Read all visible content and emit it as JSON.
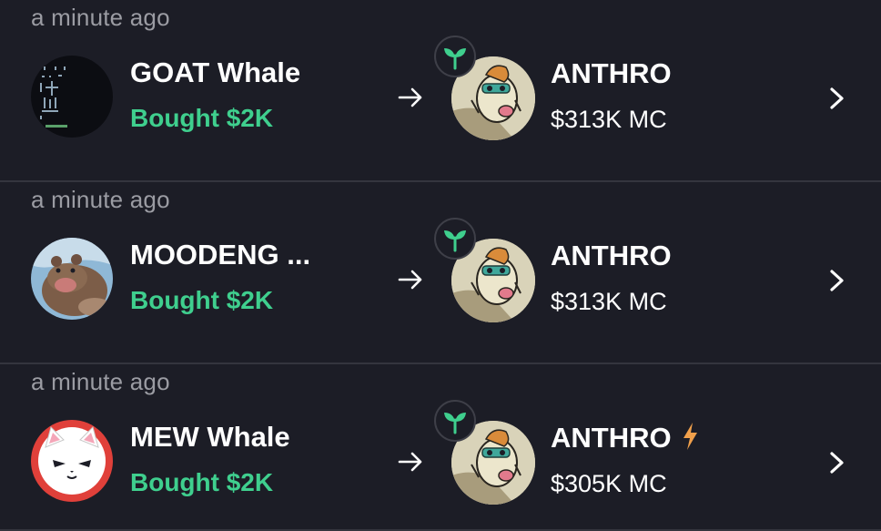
{
  "feed": {
    "entries": [
      {
        "time": "a minute ago",
        "whale_name": "GOAT Whale",
        "action": "Bought $2K",
        "avatar_icon": "goat-ascii-avatar",
        "token": {
          "name": "ANTHRO",
          "market_cap": "$313K MC",
          "badge_icon": "sprout-icon"
        }
      },
      {
        "time": "a minute ago",
        "whale_name": "MOODENG ...",
        "action": "Bought $2K",
        "avatar_icon": "hippo-avatar",
        "token": {
          "name": "ANTHRO",
          "market_cap": "$313K MC",
          "badge_icon": "sprout-icon"
        }
      },
      {
        "time": "a minute ago",
        "whale_name": "MEW Whale",
        "action": "Bought $2K",
        "avatar_icon": "cat-avatar",
        "token": {
          "name": "ANTHRO",
          "market_cap": "$305K MC",
          "badge_icon": "sprout-icon",
          "trend_icon": "lightning-icon"
        }
      }
    ]
  },
  "colors": {
    "background": "#1c1d26",
    "divider": "#34353e",
    "buy_green": "#3fcf8e",
    "muted_text": "#9b9ca3",
    "bolt_orange": "#f0a04b"
  }
}
